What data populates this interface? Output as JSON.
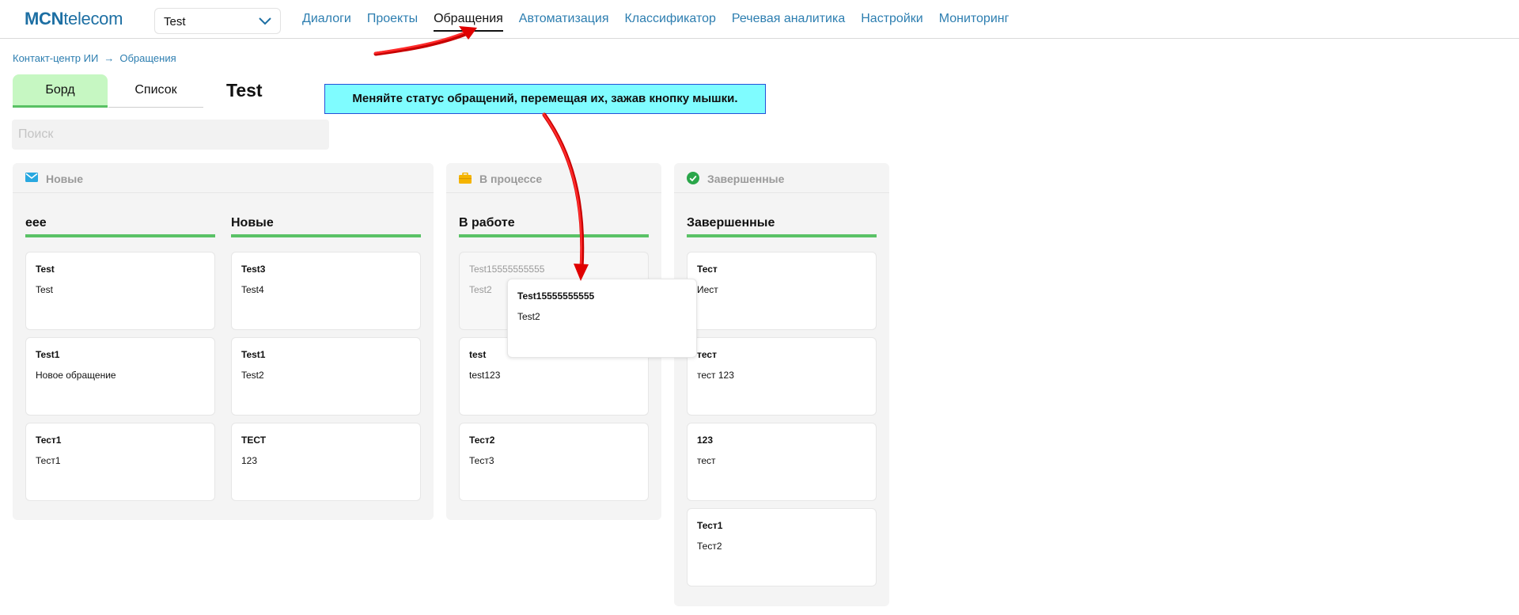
{
  "app": {
    "logo_strong": "MCN",
    "logo_rest": "telecom",
    "project_select_value": "Test"
  },
  "nav": [
    {
      "label": "Диалоги"
    },
    {
      "label": "Проекты"
    },
    {
      "label": "Обращения",
      "active": true
    },
    {
      "label": "Автоматизация"
    },
    {
      "label": "Классификатор"
    },
    {
      "label": "Речевая аналитика"
    },
    {
      "label": "Настройки"
    },
    {
      "label": "Мониторинг"
    }
  ],
  "breadcrumb": {
    "root": "Контакт-центр ИИ",
    "separator": "→",
    "current": "Обращения"
  },
  "view_switch": {
    "board": "Борд",
    "list": "Список"
  },
  "page_title": "Test",
  "search": {
    "placeholder": "Поиск",
    "value": ""
  },
  "hint": "Меняйте статус обращений, перемещая их, зажав кнопку мышки.",
  "columns": [
    {
      "name": "Новые",
      "icon": "envelope-icon",
      "icon_color": "#29a8e0",
      "lanes": [
        {
          "title": "eee",
          "cards": [
            {
              "title": "Test",
              "body": "Test"
            },
            {
              "title": "Test1",
              "body": "Новое обращение"
            },
            {
              "title": "Тест1",
              "body": "Тест1"
            }
          ]
        },
        {
          "title": "Новые",
          "cards": [
            {
              "title": "Test3",
              "body": "Test4"
            },
            {
              "title": "Test1",
              "body": "Test2"
            },
            {
              "title": "ТЕСТ",
              "body": "123"
            }
          ]
        }
      ]
    },
    {
      "name": "В процессе",
      "icon": "briefcase-icon",
      "icon_color": "#f5b400",
      "lanes": [
        {
          "title": "В работе",
          "cards": [
            {
              "title": "Test15555555555",
              "body": "Test2",
              "state": "dragging-placeholder"
            },
            {
              "title": "test",
              "body": "test123"
            },
            {
              "title": "Тест2",
              "body": "Тест3"
            }
          ]
        }
      ]
    },
    {
      "name": "Завершенные",
      "icon": "check-circle-icon",
      "icon_color": "#2aa64a",
      "lanes": [
        {
          "title": "Завершенные",
          "cards": [
            {
              "title": "Тест",
              "body": "Иест"
            },
            {
              "title": "тест",
              "body": "тест 123"
            },
            {
              "title": "123",
              "body": "тест"
            },
            {
              "title": "Тест1",
              "body": "Тест2"
            }
          ]
        }
      ]
    }
  ],
  "dragged_card": {
    "title": "Test15555555555",
    "body": "Test2"
  },
  "colors": {
    "accent_blue": "#2d7eb0",
    "lane_underline": "#5ac266",
    "active_tab_bg": "#c6f7c2",
    "hint_bg": "#7ffcff",
    "hint_border": "#2450d8",
    "annotation_arrow": "#e00000"
  }
}
